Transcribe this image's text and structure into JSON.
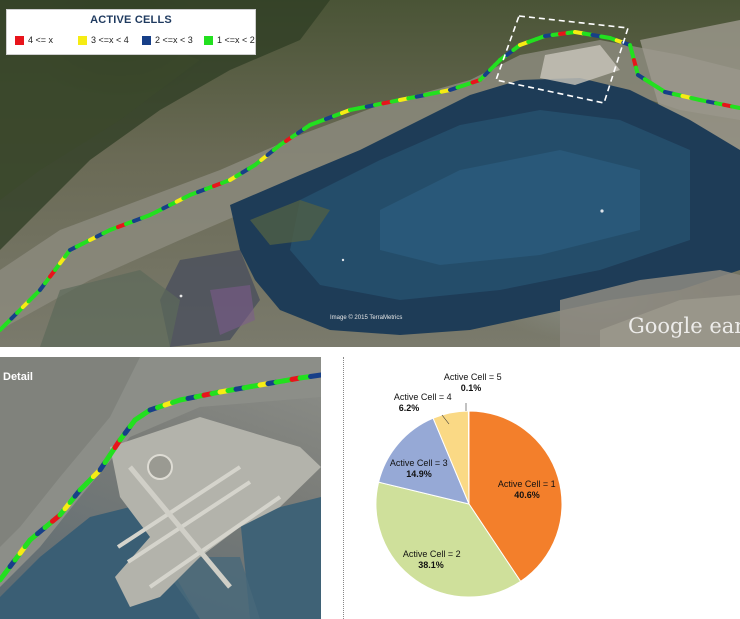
{
  "legend": {
    "title": "ACTIVE CELLS",
    "items": [
      {
        "label": "4 <= x",
        "color": "#e8141b"
      },
      {
        "label": "3 <=x < 4",
        "color": "#f6ec13"
      },
      {
        "label": "2 <=x < 3",
        "color": "#173f88"
      },
      {
        "label": "1 <=x < 2",
        "color": "#22e01f"
      }
    ]
  },
  "main_map": {
    "credit": "Image © 2015 TerraMetrics",
    "logo": "Google earth",
    "highlight": "detail-region-box"
  },
  "detail_map": {
    "label": "Detail"
  },
  "chart_data": {
    "type": "pie",
    "title": "",
    "slices": [
      {
        "label": "Active Cell = 1",
        "value": 40.6,
        "display": "40.6%",
        "color": "#f37f2b"
      },
      {
        "label": "Active Cell = 2",
        "value": 38.1,
        "display": "38.1%",
        "color": "#cfe09b"
      },
      {
        "label": "Active Cell = 3",
        "value": 14.9,
        "display": "14.9%",
        "color": "#96a9d6"
      },
      {
        "label": "Active Cell = 4",
        "value": 6.2,
        "display": "6.2%",
        "color": "#fad985"
      },
      {
        "label": "Active Cell = 5",
        "value": 0.1,
        "display": "0.1%",
        "color": "#7a7a7a"
      }
    ],
    "start_angle": "top",
    "direction": "clockwise"
  }
}
